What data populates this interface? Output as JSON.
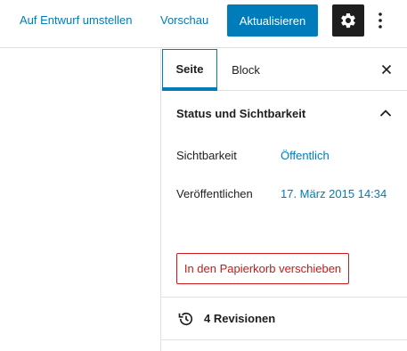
{
  "toolbar": {
    "switch_to_draft_label": "Auf Entwurf umstellen",
    "preview_label": "Vorschau",
    "update_label": "Aktualisieren",
    "settings_icon": "gear-icon",
    "more_icon": "more-vertical-icon"
  },
  "sidebar": {
    "tabs": [
      {
        "label": "Seite",
        "active": true
      },
      {
        "label": "Block",
        "active": false
      }
    ],
    "close_icon": "close-icon",
    "panel": {
      "title": "Status und Sichtbarkeit",
      "expanded": true,
      "rows": [
        {
          "label": "Sichtbarkeit",
          "value": "Öffentlich"
        },
        {
          "label": "Veröffentlichen",
          "value": "17. März 2015 14:34"
        }
      ],
      "trash_label": "In den Papierkorb verschieben"
    },
    "revisions": {
      "label": "4 Revisionen",
      "icon": "history-icon"
    }
  },
  "colors": {
    "accent": "#007cba",
    "danger": "#cc1818",
    "dark": "#1e1e1e",
    "border": "#e0e0e0"
  }
}
